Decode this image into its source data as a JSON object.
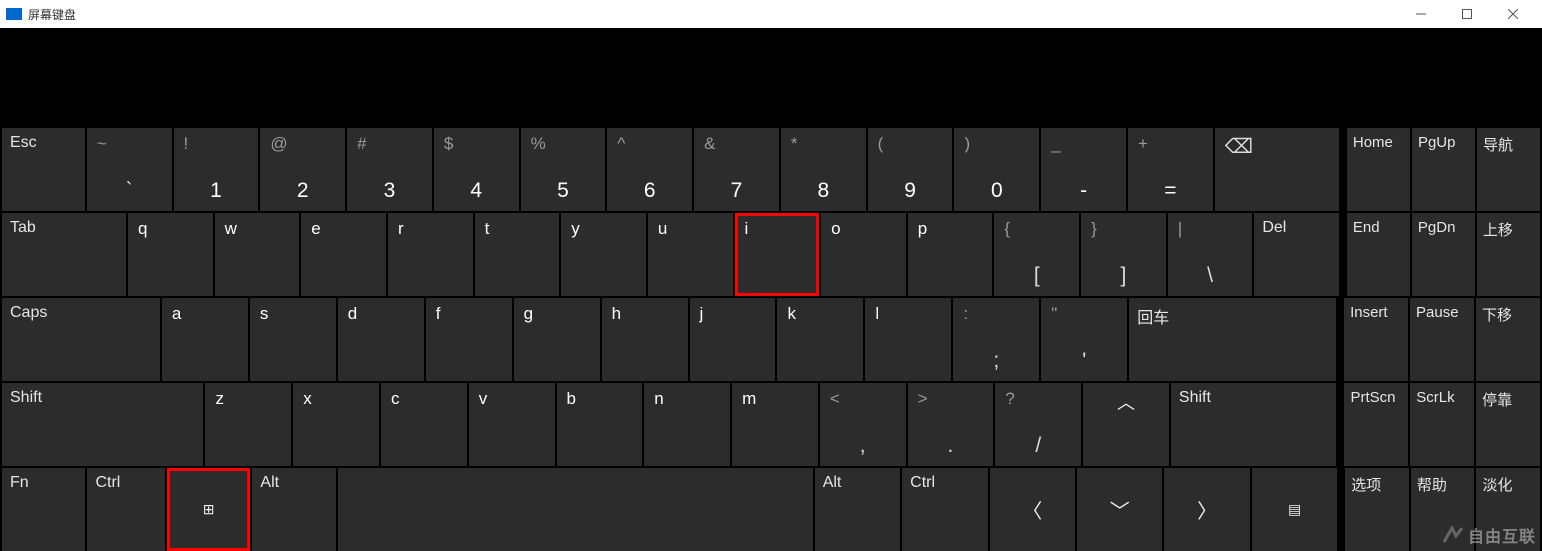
{
  "window": {
    "title": "屏幕键盘"
  },
  "rows": {
    "r1": {
      "esc": "Esc",
      "keys": [
        {
          "u": "~",
          "l": "`"
        },
        {
          "u": "!",
          "l": "1"
        },
        {
          "u": "@",
          "l": "2"
        },
        {
          "u": "#",
          "l": "3"
        },
        {
          "u": "$",
          "l": "4"
        },
        {
          "u": "%",
          "l": "5"
        },
        {
          "u": "^",
          "l": "6"
        },
        {
          "u": "&",
          "l": "7"
        },
        {
          "u": "*",
          "l": "8"
        },
        {
          "u": "(",
          "l": "9"
        },
        {
          "u": ")",
          "l": "0"
        },
        {
          "u": "_",
          "l": "-"
        },
        {
          "u": "+",
          "l": "="
        }
      ],
      "backspace_icon": "⌫",
      "nav": [
        "Home",
        "PgUp",
        "导航"
      ]
    },
    "r2": {
      "tab": "Tab",
      "keys": [
        "q",
        "w",
        "e",
        "r",
        "t",
        "y",
        "u",
        "i",
        "o",
        "p"
      ],
      "brackets": [
        {
          "u": "{",
          "l": "["
        },
        {
          "u": "}",
          "l": "]"
        },
        {
          "u": "|",
          "l": "\\"
        }
      ],
      "del": "Del",
      "nav": [
        "End",
        "PgDn",
        "上移"
      ]
    },
    "r3": {
      "caps": "Caps",
      "keys": [
        "a",
        "s",
        "d",
        "f",
        "g",
        "h",
        "j",
        "k",
        "l"
      ],
      "punct": [
        {
          "u": ":",
          "l": ";"
        },
        {
          "u": "\"",
          "l": "'"
        }
      ],
      "enter": "回车",
      "nav": [
        "Insert",
        "Pause",
        "下移"
      ]
    },
    "r4": {
      "shiftL": "Shift",
      "keys": [
        "z",
        "x",
        "c",
        "v",
        "b",
        "n",
        "m"
      ],
      "punct": [
        {
          "u": "<",
          "l": ","
        },
        {
          "u": ">",
          "l": "."
        },
        {
          "u": "?",
          "l": "/"
        }
      ],
      "up_icon": "︿",
      "shiftR": "Shift",
      "nav": [
        "PrtScn",
        "ScrLk",
        "停靠"
      ]
    },
    "r5": {
      "fn": "Fn",
      "ctrlL": "Ctrl",
      "win": "⊞",
      "altL": "Alt",
      "space": "",
      "altR": "Alt",
      "ctrlR": "Ctrl",
      "left_icon": "〈",
      "down_icon": "﹀",
      "right_icon": "〉",
      "menu_icon": "▤",
      "nav": [
        "选项",
        "帮助",
        "淡化"
      ]
    }
  },
  "watermark": "自由互联"
}
